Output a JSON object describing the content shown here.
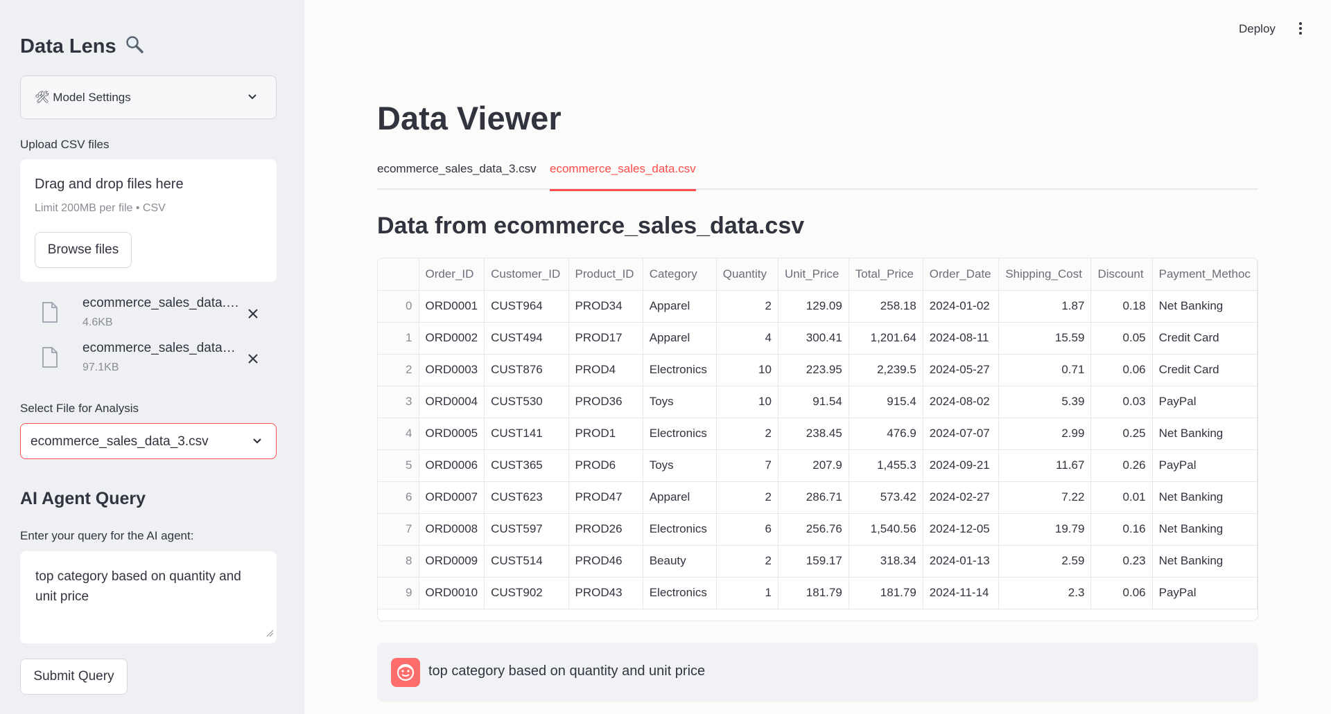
{
  "sidebar": {
    "app_title": "Data Lens",
    "model_settings_label": "🛠 Model Settings",
    "upload_label": "Upload CSV files",
    "dropzone_title": "Drag and drop files here",
    "dropzone_limit": "Limit 200MB per file • CSV",
    "browse_label": "Browse files",
    "files": [
      {
        "name": "ecommerce_sales_data.…",
        "size": "4.6KB"
      },
      {
        "name": "ecommerce_sales_data…",
        "size": "97.1KB"
      }
    ],
    "select_label": "Select File for Analysis",
    "select_value": "ecommerce_sales_data_3.csv",
    "ai_heading": "AI Agent Query",
    "query_label": "Enter your query for the AI agent:",
    "query_value": "top category based on quantity and unit price",
    "submit_label": "Submit Query"
  },
  "header": {
    "deploy_label": "Deploy"
  },
  "main": {
    "title": "Data Viewer",
    "tabs": [
      {
        "label": "ecommerce_sales_data_3.csv",
        "active": false
      },
      {
        "label": "ecommerce_sales_data.csv",
        "active": true
      }
    ],
    "section_title": "Data from ecommerce_sales_data.csv",
    "table": {
      "columns": [
        "",
        "Order_ID",
        "Customer_ID",
        "Product_ID",
        "Category",
        "Quantity",
        "Unit_Price",
        "Total_Price",
        "Order_Date",
        "Shipping_Cost",
        "Discount",
        "Payment_Methoc"
      ],
      "rows": [
        [
          "0",
          "ORD0001",
          "CUST964",
          "PROD34",
          "Apparel",
          "2",
          "129.09",
          "258.18",
          "2024-01-02",
          "1.87",
          "0.18",
          "Net Banking"
        ],
        [
          "1",
          "ORD0002",
          "CUST494",
          "PROD17",
          "Apparel",
          "4",
          "300.41",
          "1,201.64",
          "2024-08-11",
          "15.59",
          "0.05",
          "Credit Card"
        ],
        [
          "2",
          "ORD0003",
          "CUST876",
          "PROD4",
          "Electronics",
          "10",
          "223.95",
          "2,239.5",
          "2024-05-27",
          "0.71",
          "0.06",
          "Credit Card"
        ],
        [
          "3",
          "ORD0004",
          "CUST530",
          "PROD36",
          "Toys",
          "10",
          "91.54",
          "915.4",
          "2024-08-02",
          "5.39",
          "0.03",
          "PayPal"
        ],
        [
          "4",
          "ORD0005",
          "CUST141",
          "PROD1",
          "Electronics",
          "2",
          "238.45",
          "476.9",
          "2024-07-07",
          "2.99",
          "0.25",
          "Net Banking"
        ],
        [
          "5",
          "ORD0006",
          "CUST365",
          "PROD6",
          "Toys",
          "7",
          "207.9",
          "1,455.3",
          "2024-09-21",
          "11.67",
          "0.26",
          "PayPal"
        ],
        [
          "6",
          "ORD0007",
          "CUST623",
          "PROD47",
          "Apparel",
          "2",
          "286.71",
          "573.42",
          "2024-02-27",
          "7.22",
          "0.01",
          "Net Banking"
        ],
        [
          "7",
          "ORD0008",
          "CUST597",
          "PROD26",
          "Electronics",
          "6",
          "256.76",
          "1,540.56",
          "2024-12-05",
          "19.79",
          "0.16",
          "Net Banking"
        ],
        [
          "8",
          "ORD0009",
          "CUST514",
          "PROD46",
          "Beauty",
          "2",
          "159.17",
          "318.34",
          "2024-01-13",
          "2.59",
          "0.23",
          "Net Banking"
        ],
        [
          "9",
          "ORD0010",
          "CUST902",
          "PROD43",
          "Electronics",
          "1",
          "181.79",
          "181.79",
          "2024-11-14",
          "2.3",
          "0.06",
          "PayPal"
        ]
      ]
    },
    "chat_message": "top category based on quantity and unit price"
  },
  "colors": {
    "accent": "#ff4b4b",
    "sidebar_bg": "#eef0f4",
    "text": "#31333f"
  }
}
